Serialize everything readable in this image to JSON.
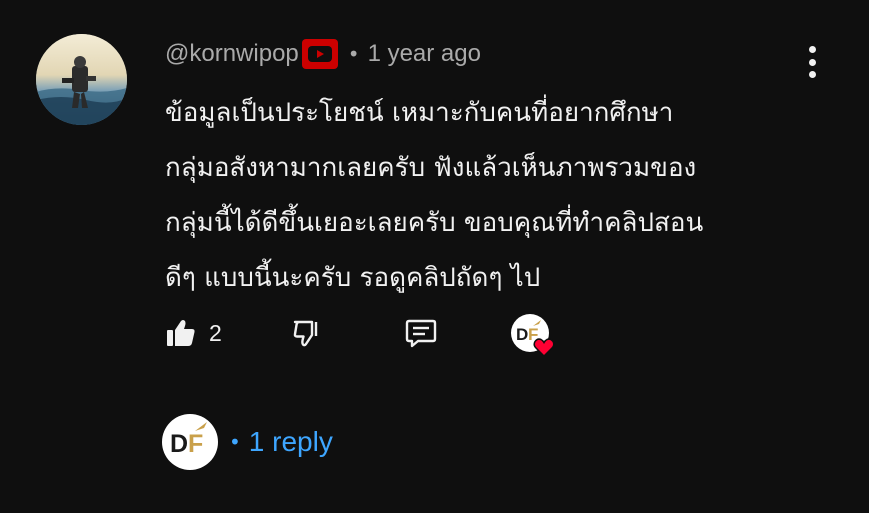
{
  "comment": {
    "author_handle": "@kornwipop",
    "member_badge": "youtube-play-icon",
    "separator": "•",
    "timestamp": "1 year ago",
    "menu_icon": "more-vert-icon",
    "text_lines": [
      "ข้อมูลเป็นประโยชน์ เหมาะกับคนที่อยากศึกษา",
      "กลุ่มอสังหามากเลยครับ ฟังแล้วเห็นภาพรวมของ",
      "กลุ่มนี้ได้ดีขึ้นเยอะเลยครับ ขอบคุณที่ทำคลิปสอน",
      "ดีๆ แบบนี้นะครับ รอดูคลิปถัดๆ ไป"
    ],
    "actions": {
      "like_count": "2",
      "like_icon": "thumb-up-icon",
      "dislike_icon": "thumb-down-icon",
      "reply_icon": "reply-comment-icon",
      "creator_heart_icon": "creator-heart-icon"
    },
    "replies": {
      "separator": "•",
      "label": "1 reply"
    }
  },
  "colors": {
    "background": "#0f0f0f",
    "text_primary": "#f1f1f1",
    "text_secondary": "#aaaaaa",
    "link_blue": "#3ea6ff",
    "badge_red": "#cc0000",
    "heart_red": "#ff0033"
  }
}
